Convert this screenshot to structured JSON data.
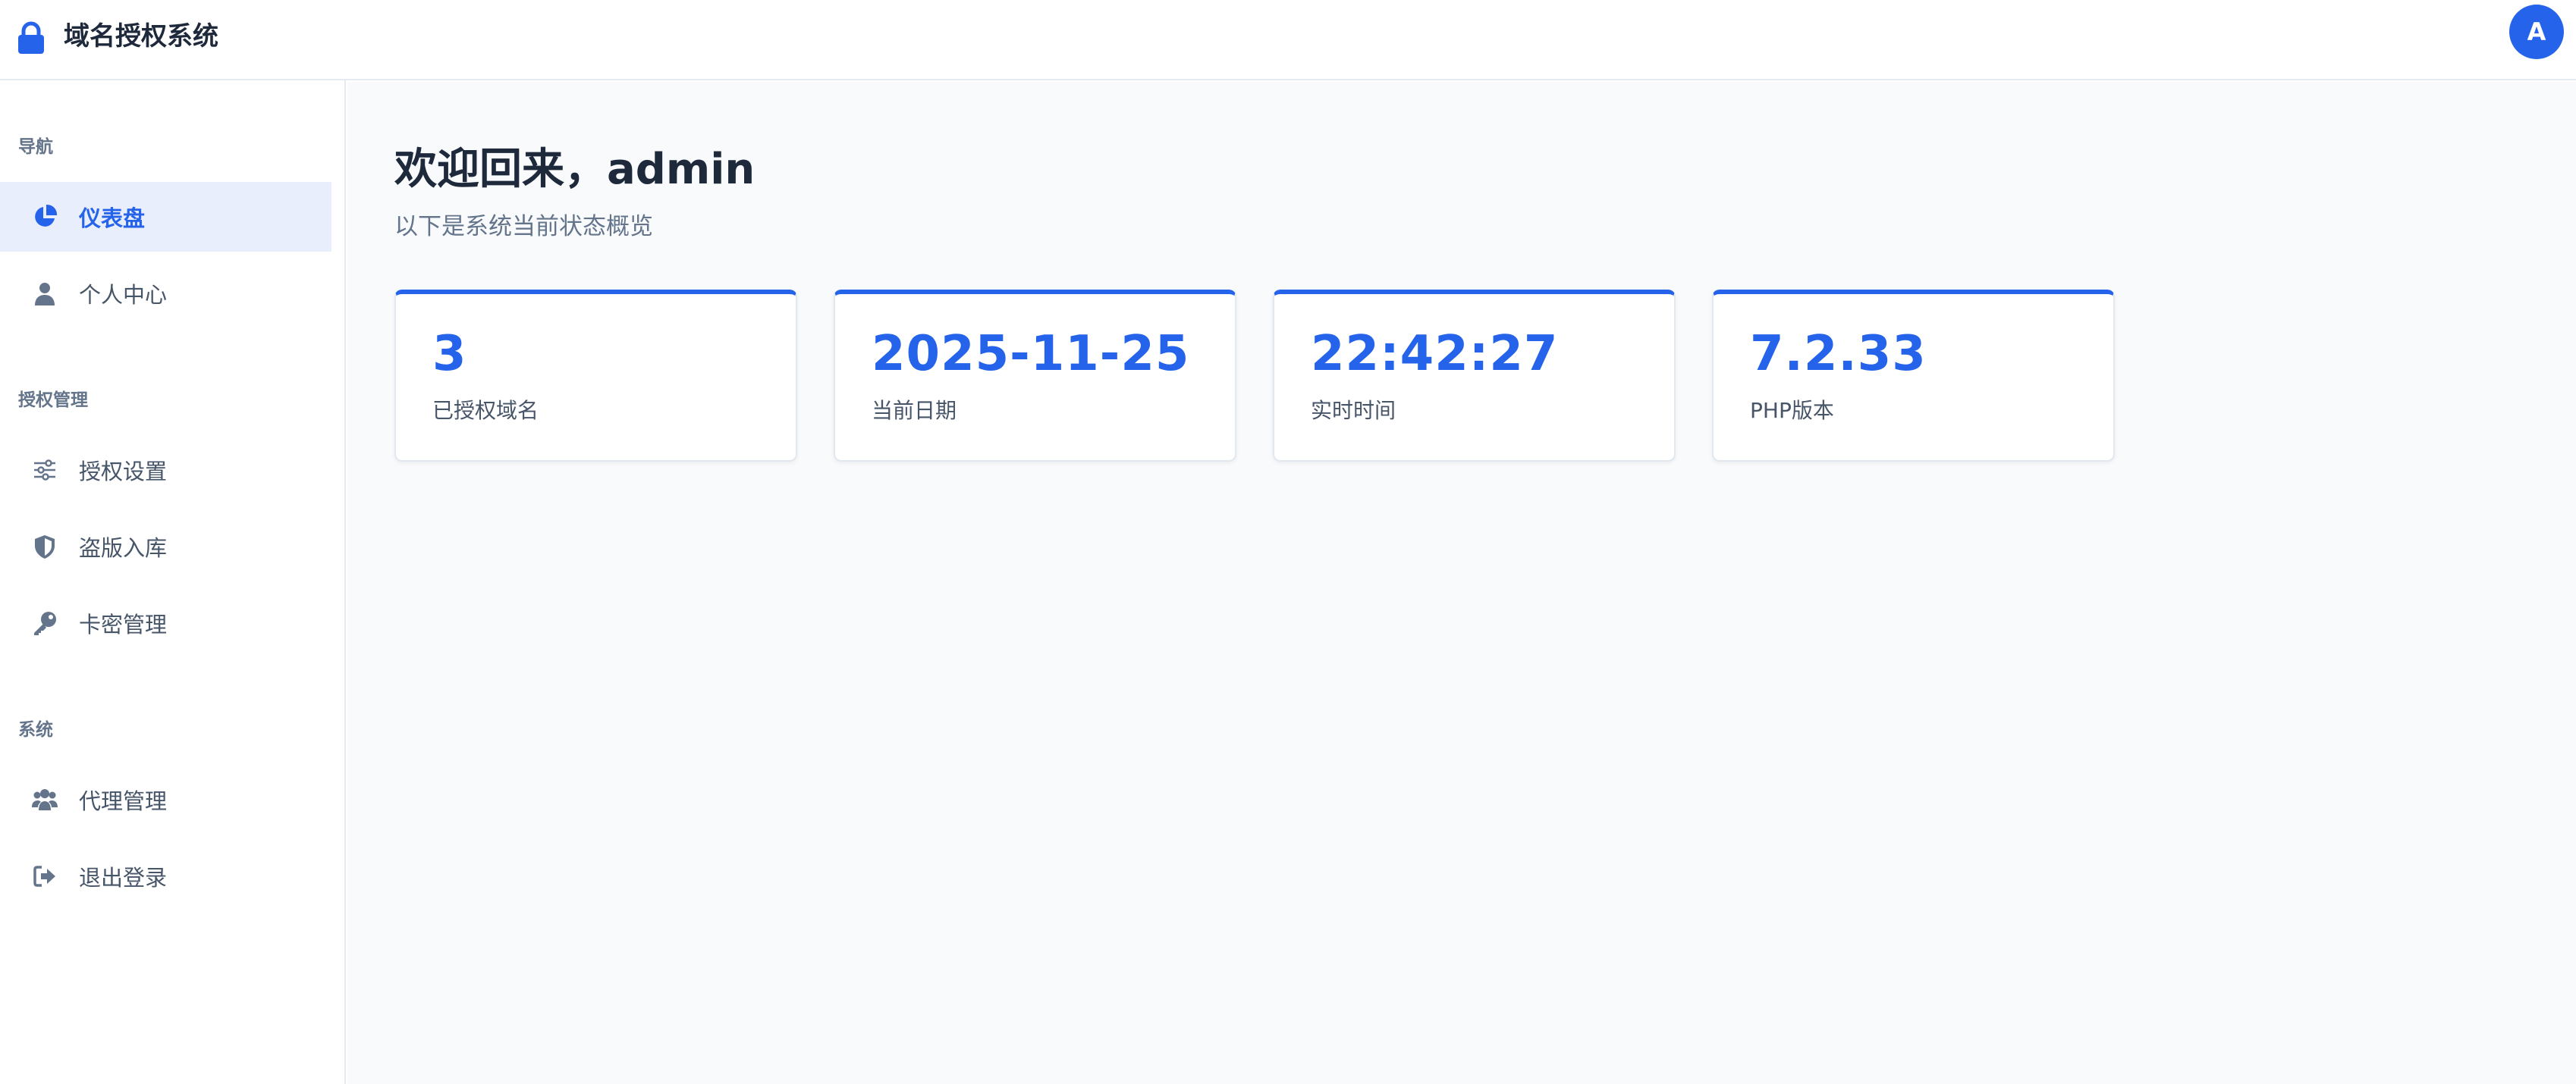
{
  "header": {
    "title": "域名授权系统",
    "brand_icon": "lock-icon",
    "avatar_letter": "A",
    "accent": "#2563eb"
  },
  "sidebar": {
    "sections": [
      {
        "title": "导航",
        "items": [
          {
            "label": "仪表盘",
            "icon": "pie-chart-icon",
            "active": true
          },
          {
            "label": "个人中心",
            "icon": "user-icon",
            "active": false
          }
        ]
      },
      {
        "title": "授权管理",
        "items": [
          {
            "label": "授权设置",
            "icon": "sliders-icon",
            "active": false
          },
          {
            "label": "盗版入库",
            "icon": "shield-icon",
            "active": false
          },
          {
            "label": "卡密管理",
            "icon": "key-icon",
            "active": false
          }
        ]
      },
      {
        "title": "系统",
        "items": [
          {
            "label": "代理管理",
            "icon": "users-icon",
            "active": false
          },
          {
            "label": "退出登录",
            "icon": "logout-icon",
            "active": false
          }
        ]
      }
    ]
  },
  "main": {
    "welcome": "欢迎回来，admin",
    "subtitle": "以下是系统当前状态概览",
    "stats": [
      {
        "value": "3",
        "label": "已授权域名"
      },
      {
        "value": "2025-11-25",
        "label": "当前日期"
      },
      {
        "value": "22:42:27",
        "label": "实时时间"
      },
      {
        "value": "7.2.33",
        "label": "PHP版本"
      }
    ]
  }
}
